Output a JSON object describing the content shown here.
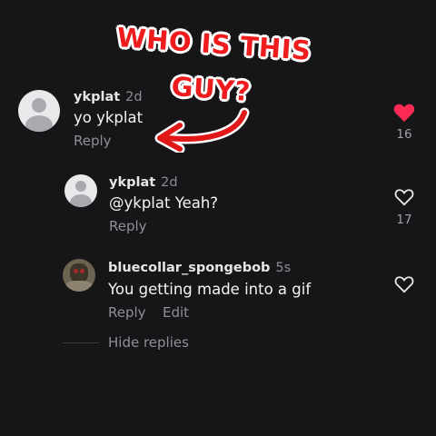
{
  "overlay": {
    "line1": "WHO IS THIS",
    "line2": "GUY?"
  },
  "comments": [
    {
      "username": "ykplat",
      "time": "2d",
      "text": "yo ykplat",
      "reply_label": "Reply",
      "likes": "16",
      "liked": true
    },
    {
      "username": "ykplat",
      "time": "2d",
      "text": "@ykplat Yeah?",
      "reply_label": "Reply",
      "likes": "17",
      "liked": false
    },
    {
      "username": "bluecollar_spongebob",
      "time": "5s",
      "text": "You getting made into a gif",
      "reply_label": "Reply",
      "edit_label": "Edit",
      "liked": false
    }
  ],
  "hide_replies_label": "Hide replies",
  "colors": {
    "background": "#161618",
    "liked_heart": "#fe2c55",
    "overlay_red": "#ee1c1c"
  }
}
